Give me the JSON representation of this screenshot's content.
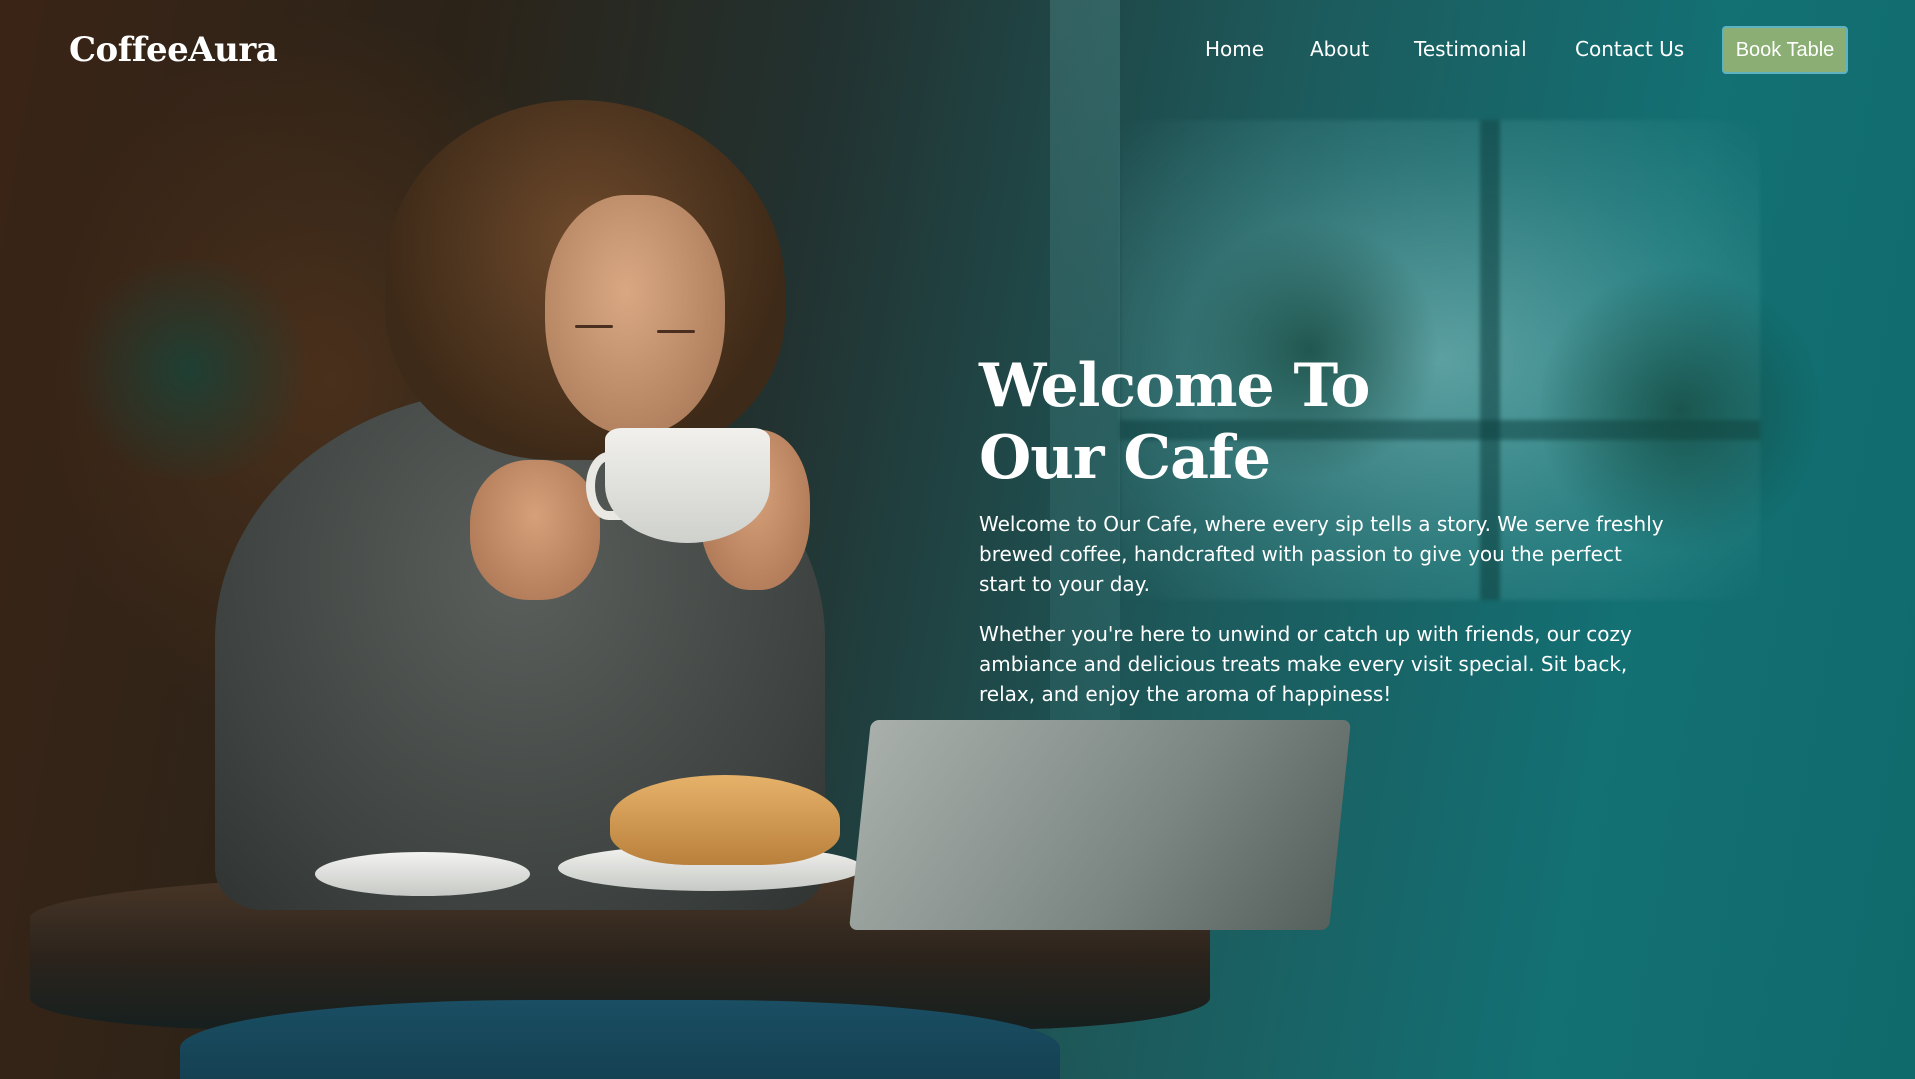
{
  "header": {
    "logo": "CoffeeAura",
    "nav": [
      {
        "label": "Home"
      },
      {
        "label": "About"
      },
      {
        "label": "Testimonial"
      },
      {
        "label": "Contact Us"
      }
    ],
    "cta_label": "Book Table"
  },
  "hero": {
    "title_line1": "Welcome To",
    "title_line2": "Our Cafe",
    "paragraph1": "Welcome to Our Cafe, where every sip tells a story. We serve freshly brewed coffee, handcrafted with passion to give you the perfect start to your day.",
    "paragraph2": "Whether you're here to unwind or catch up with friends, our cozy ambiance and delicious treats make every visit special. Sit back, relax, and enjoy the aroma of happiness!"
  },
  "colors": {
    "cta_background": "#8aae73",
    "cta_border": "#5fb3c0",
    "overlay_teal": "#137073",
    "text": "#ffffff"
  }
}
